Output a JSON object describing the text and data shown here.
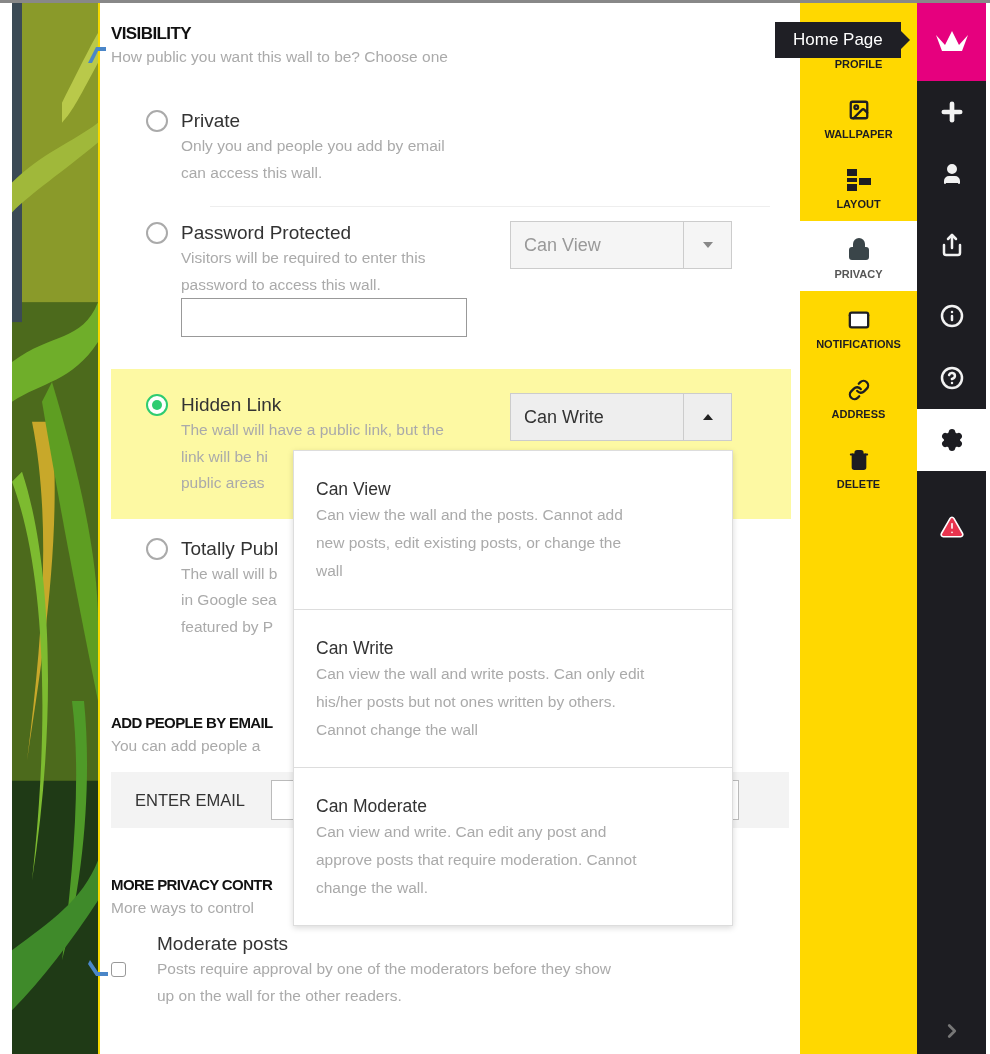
{
  "visibility": {
    "heading": "VISIBILITY",
    "subtitle": "How public you want this wall to be? Choose one",
    "options": [
      {
        "kind": "plain",
        "label": "Private",
        "lines": [
          "Only you and people you add by email",
          "can access this wall."
        ],
        "selected": false
      },
      {
        "kind": "password",
        "label": "Password Protected",
        "lines": [
          "Visitors will be required to enter this",
          "password to access this wall."
        ],
        "selected": false,
        "select": {
          "value": "Can View",
          "expanded": false
        }
      },
      {
        "kind": "plain",
        "label": "Hidden Link",
        "lines": [
          "The wall will have a public link, but the",
          "link will be hi",
          "public areas"
        ],
        "selected": true,
        "select": {
          "value": "Can Write",
          "expanded": true
        }
      },
      {
        "kind": "plain",
        "label": "Totally Publ",
        "lines": [
          "The wall will b",
          "in Google sea",
          "featured by P"
        ],
        "selected": false
      }
    ]
  },
  "menu": [
    {
      "title": "Can View",
      "lines": [
        "Can view the wall and the posts. Cannot add",
        "new posts, edit existing posts, or change the",
        "wall"
      ]
    },
    {
      "title": "Can Write",
      "lines": [
        "Can view the wall and write posts. Can only edit",
        "his/her posts but not ones written by others.",
        "Cannot change the wall"
      ]
    },
    {
      "title": "Can Moderate",
      "lines": [
        "Can view and write. Can edit any post and",
        "approve posts that require moderation. Cannot",
        "change the wall."
      ]
    }
  ],
  "add_people": {
    "heading": "ADD PEOPLE BY EMAIL",
    "subtitle": "You can add people a",
    "email_label": "ENTER EMAIL"
  },
  "more_privacy": {
    "heading": "MORE PRIVACY CONTR",
    "subtitle": "More ways to control",
    "checkbox": {
      "label": "Moderate posts",
      "description": "Posts require approval by one of the moderators before they show up on the wall for the other readers.",
      "checked": false
    }
  },
  "sidebar": [
    {
      "kind": "profile",
      "label": "PROFILE",
      "selected": false
    },
    {
      "kind": "wallpaper",
      "label": "WALLPAPER",
      "selected": false
    },
    {
      "kind": "layout",
      "label": "LAYOUT",
      "selected": false
    },
    {
      "kind": "privacy",
      "label": "PRIVACY",
      "selected": true
    },
    {
      "kind": "notifications",
      "label": "NOTIFICATIONS",
      "selected": false
    },
    {
      "kind": "address",
      "label": "ADDRESS",
      "selected": false
    },
    {
      "kind": "delete",
      "label": "DELETE",
      "selected": false
    }
  ],
  "rail": [
    {
      "kind": "logo",
      "selected": false
    },
    {
      "kind": "add",
      "selected": false
    },
    {
      "kind": "user",
      "selected": false
    },
    {
      "kind": "share",
      "selected": false
    },
    {
      "kind": "info",
      "selected": false
    },
    {
      "kind": "help",
      "selected": false
    },
    {
      "kind": "settings",
      "selected": true
    },
    {
      "kind": "alert",
      "selected": false
    },
    {
      "kind": "expand",
      "selected": false
    }
  ],
  "tooltip": "Home Page"
}
